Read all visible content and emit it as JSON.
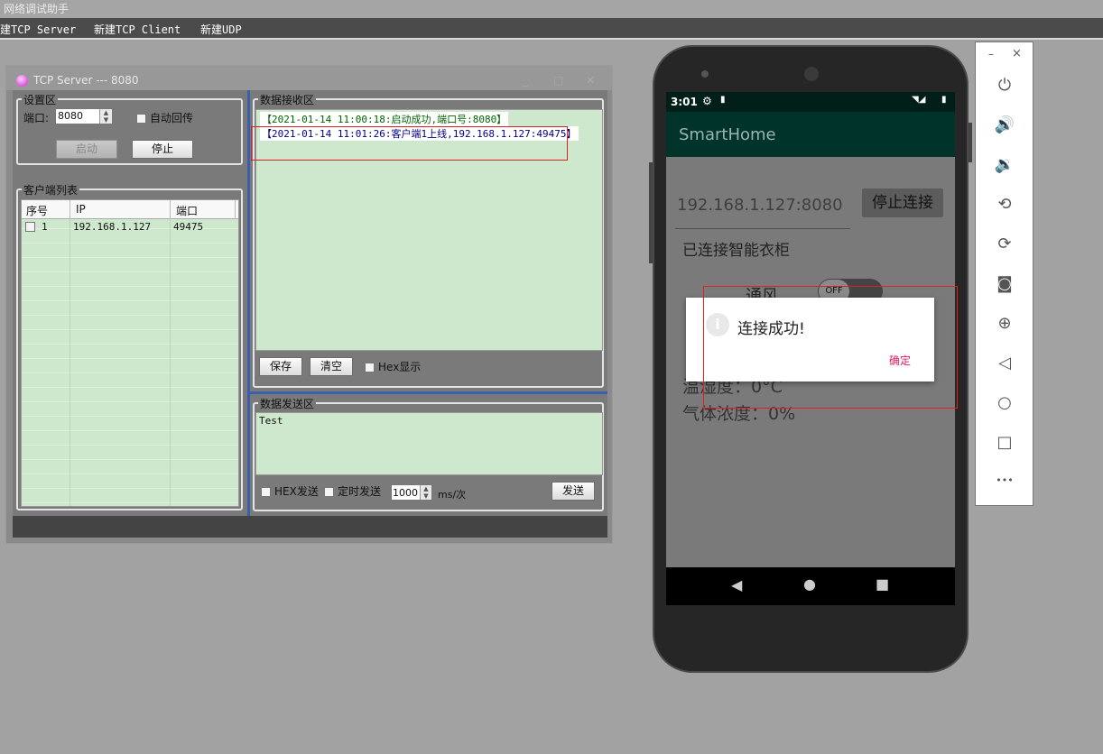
{
  "app": {
    "title": "网络调试助手"
  },
  "menu": {
    "items": [
      "建TCP Server",
      "新建TCP Client",
      "新建UDP"
    ]
  },
  "window": {
    "title": "TCP Server --- 8080"
  },
  "settings": {
    "group_label": "设置区",
    "port_label": "端口:",
    "port_value": "8080",
    "auto_reply_label": "自动回传",
    "start_label": "启动",
    "stop_label": "停止"
  },
  "clients": {
    "group_label": "客户端列表",
    "columns": [
      "序号",
      "IP",
      "端口"
    ],
    "rows": [
      {
        "no": "1",
        "ip": "192.168.1.127",
        "port": "49475"
      }
    ]
  },
  "receive": {
    "group_label": "数据接收区",
    "lines": [
      "【2021-01-14 11:00:18:启动成功,端口号:8080】",
      "【2021-01-14 11:01:26:客户端1上线,192.168.1.127:49475】"
    ],
    "line_colors": [
      "#006400",
      "#00008b"
    ],
    "save_label": "保存",
    "clear_label": "清空",
    "hex_display_label": "Hex显示"
  },
  "send": {
    "group_label": "数据发送区",
    "text": "Test",
    "hex_send_label": "HEX发送",
    "timed_send_label": "定时发送",
    "interval_value": "1000",
    "interval_unit": "ms/次",
    "send_label": "发送"
  },
  "phone": {
    "time": "3:01",
    "app_title": "SmartHome",
    "address_value": "192.168.1.127:8080",
    "disconnect_label": "停止连接",
    "status_text": "已连接智能衣柜",
    "fan_label": "通风",
    "fan_toggle_label": "OFF",
    "humidity_text": "温湿度：0°C",
    "gas_text": "气体浓度：0%",
    "dialog": {
      "message": "连接成功!",
      "ok_label": "确定"
    },
    "accent_color": "#00332a"
  },
  "emulator": {
    "close": "×",
    "minimize": "–",
    "more": "•••"
  }
}
